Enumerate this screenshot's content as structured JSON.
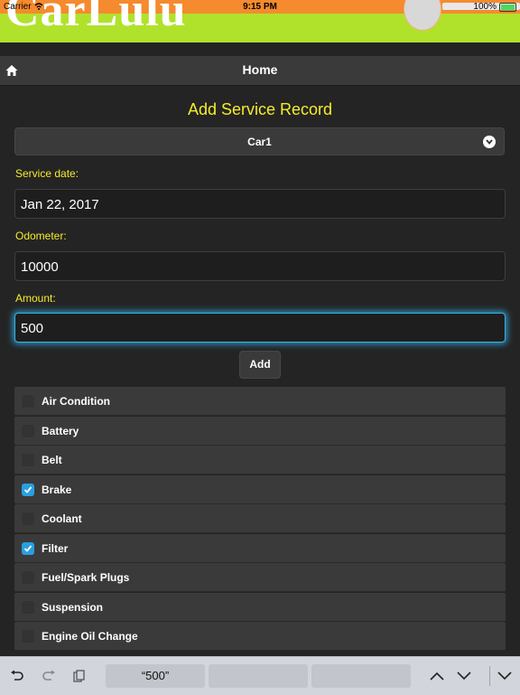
{
  "status_bar": {
    "carrier": "Carrier",
    "time": "9:15 PM",
    "battery": "100%"
  },
  "banner": {
    "logo": "CarLulu"
  },
  "header": {
    "title": "Home"
  },
  "form": {
    "title": "Add Service Record",
    "car": "Car1",
    "service_date_label": "Service date:",
    "service_date": "Jan 22, 2017",
    "odometer_label": "Odometer:",
    "odometer": "10000",
    "amount_label": "Amount:",
    "amount": "500",
    "add_label": "Add"
  },
  "services": [
    {
      "label": "Air Condition",
      "checked": false
    },
    {
      "label": "Battery",
      "checked": false
    },
    {
      "label": "Belt",
      "checked": false
    },
    {
      "label": "Brake",
      "checked": true
    },
    {
      "label": "Coolant",
      "checked": false
    },
    {
      "label": "Filter",
      "checked": true
    },
    {
      "label": "Fuel/Spark Plugs",
      "checked": false
    },
    {
      "label": "Suspension",
      "checked": false
    },
    {
      "label": "Engine Oil Change",
      "checked": false
    }
  ],
  "keyboard_bar": {
    "suggestion_1": "“500”",
    "suggestion_2": "",
    "suggestion_3": ""
  },
  "colors": {
    "accent_yellow": "#f5ec2a",
    "banner_green": "#b0e22c",
    "banner_orange": "#f58a2e",
    "checkbox_blue": "#2a9fe0"
  }
}
